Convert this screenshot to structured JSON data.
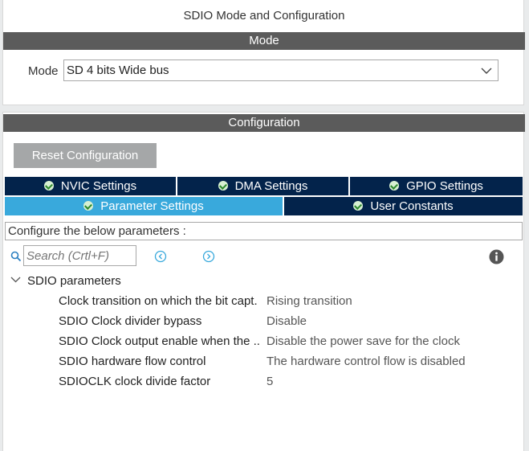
{
  "panel": {
    "title": "SDIO Mode and Configuration",
    "mode_bar": "Mode",
    "mode_label": "Mode",
    "mode_value": "SD 4 bits Wide bus",
    "config_bar": "Configuration"
  },
  "config": {
    "reset_label": "Reset Configuration",
    "tabs": [
      {
        "label": "NVIC Settings",
        "active": false
      },
      {
        "label": "DMA Settings",
        "active": false
      },
      {
        "label": "GPIO Settings",
        "active": false
      },
      {
        "label": "Parameter Settings",
        "active": true
      },
      {
        "label": "User Constants",
        "active": false
      }
    ],
    "hint": "Configure the below parameters :",
    "search_placeholder": "Search (Crtl+F)",
    "group_title": "SDIO parameters",
    "params": [
      {
        "name": "Clock transition on which the bit capt.",
        "value": "Rising transition"
      },
      {
        "name": "SDIO Clock divider bypass",
        "value": "Disable"
      },
      {
        "name": "SDIO Clock output enable when the ..",
        "value": "Disable the power save for the clock"
      },
      {
        "name": "SDIO hardware flow control",
        "value": "The hardware control flow is disabled"
      },
      {
        "name": "SDIOCLK clock divide factor",
        "value": "5"
      }
    ]
  },
  "colors": {
    "bar": "#5b5b5b",
    "tab_dark": "#03234b",
    "tab_active": "#39a9dc",
    "button": "#a5a7a8"
  }
}
